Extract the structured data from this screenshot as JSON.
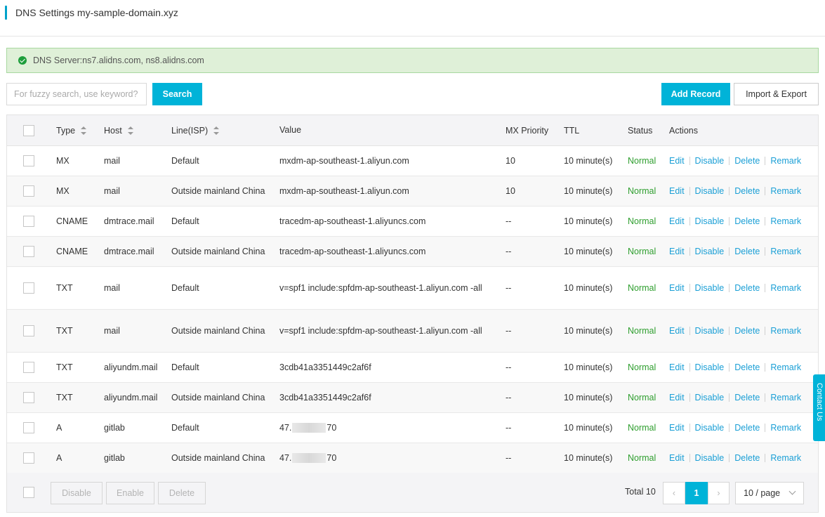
{
  "header": {
    "title": "DNS Settings my-sample-domain.xyz"
  },
  "alert": {
    "text": "DNS Server:ns7.alidns.com, ns8.alidns.com"
  },
  "toolbar": {
    "search_placeholder": "For fuzzy search, use keyword?",
    "search_label": "Search",
    "add_label": "Add Record",
    "import_label": "Import & Export"
  },
  "table": {
    "headers": {
      "type": "Type",
      "host": "Host",
      "line": "Line(ISP)",
      "value": "Value",
      "mx": "MX Priority",
      "ttl": "TTL",
      "status": "Status",
      "actions": "Actions"
    },
    "action_labels": {
      "edit": "Edit",
      "disable": "Disable",
      "delete": "Delete",
      "remark": "Remark"
    },
    "rows": [
      {
        "type": "MX",
        "host": "mail",
        "line": "Default",
        "value": "mxdm-ap-southeast-1.aliyun.com",
        "mx": "10",
        "ttl": "10 minute(s)",
        "status": "Normal"
      },
      {
        "type": "MX",
        "host": "mail",
        "line": "Outside mainland China",
        "value": "mxdm-ap-southeast-1.aliyun.com",
        "mx": "10",
        "ttl": "10 minute(s)",
        "status": "Normal"
      },
      {
        "type": "CNAME",
        "host": "dmtrace.mail",
        "line": "Default",
        "value": "tracedm-ap-southeast-1.aliyuncs.com",
        "mx": "--",
        "ttl": "10 minute(s)",
        "status": "Normal"
      },
      {
        "type": "CNAME",
        "host": "dmtrace.mail",
        "line": "Outside mainland China",
        "value": "tracedm-ap-southeast-1.aliyuncs.com",
        "mx": "--",
        "ttl": "10 minute(s)",
        "status": "Normal"
      },
      {
        "type": "TXT",
        "host": "mail",
        "line": "Default",
        "value": "v=spf1 include:spfdm-ap-southeast-1.aliyun.com -all",
        "mx": "--",
        "ttl": "10 minute(s)",
        "status": "Normal"
      },
      {
        "type": "TXT",
        "host": "mail",
        "line": "Outside mainland China",
        "value": "v=spf1 include:spfdm-ap-southeast-1.aliyun.com -all",
        "mx": "--",
        "ttl": "10 minute(s)",
        "status": "Normal"
      },
      {
        "type": "TXT",
        "host": "aliyundm.mail",
        "line": "Default",
        "value": "3cdb41a3351449c2af6f",
        "mx": "--",
        "ttl": "10 minute(s)",
        "status": "Normal"
      },
      {
        "type": "TXT",
        "host": "aliyundm.mail",
        "line": "Outside mainland China",
        "value": "3cdb41a3351449c2af6f",
        "mx": "--",
        "ttl": "10 minute(s)",
        "status": "Normal"
      },
      {
        "type": "A",
        "host": "gitlab",
        "line": "Default",
        "value_prefix": "47.",
        "value_suffix": "70",
        "mx": "--",
        "ttl": "10 minute(s)",
        "status": "Normal"
      },
      {
        "type": "A",
        "host": "gitlab",
        "line": "Outside mainland China",
        "value_prefix": "47.",
        "value_suffix": "70",
        "mx": "--",
        "ttl": "10 minute(s)",
        "status": "Normal"
      }
    ]
  },
  "footer": {
    "disable_label": "Disable",
    "enable_label": "Enable",
    "delete_label": "Delete",
    "total_text": "Total 10",
    "current_page": "1",
    "page_size": "10 / page"
  },
  "contact": {
    "label": "Contact Us"
  },
  "colors": {
    "accent": "#00b3d8",
    "status_normal": "#2e9e2e",
    "link": "#1a9fd6"
  }
}
